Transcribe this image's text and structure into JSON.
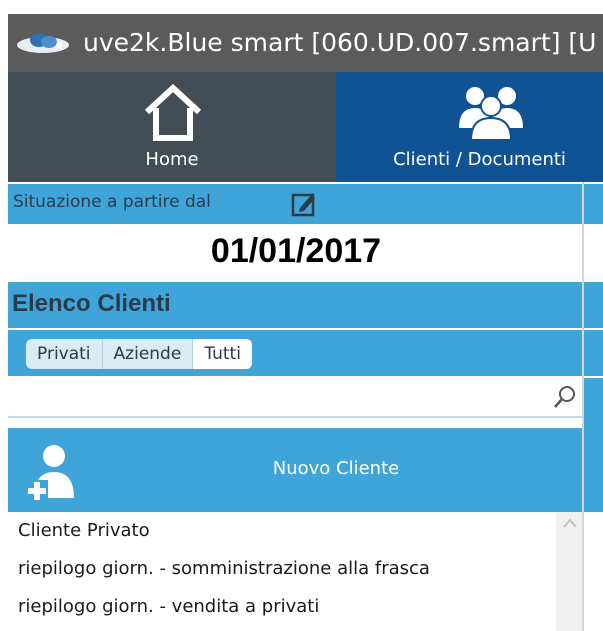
{
  "window": {
    "title": "uve2k.Blue smart [060.UD.007.smart] [U",
    "app_icon": "cloud-icon"
  },
  "ribbon": {
    "tabs": [
      {
        "label": "Home",
        "icon": "home-icon",
        "bg": "#434d56"
      },
      {
        "label": "Clienti / Documenti",
        "icon": "users-icon",
        "bg": "#0f5394"
      }
    ]
  },
  "panel": {
    "situazione_label": "Situazione a partire dal",
    "edit_icon": "edit-icon",
    "date": "01/01/2017",
    "elenco_label": "Elenco Clienti",
    "filters": [
      {
        "label": "Privati",
        "active": false
      },
      {
        "label": "Aziende",
        "active": false
      },
      {
        "label": "Tutti",
        "active": true
      }
    ],
    "search": {
      "value": "",
      "placeholder": "",
      "icon": "search-icon"
    },
    "nuovo_cliente_label": "Nuovo Cliente",
    "list_items": [
      "Cliente Privato",
      "riepilogo giorn. - somministrazione alla frasca",
      "riepilogo giorn. - vendita a privati"
    ]
  },
  "colors": {
    "accent_blue": "#3fa5d9",
    "dark_tab": "#434d56",
    "active_tab": "#0f5394",
    "titlebar": "#5b5b5b"
  }
}
